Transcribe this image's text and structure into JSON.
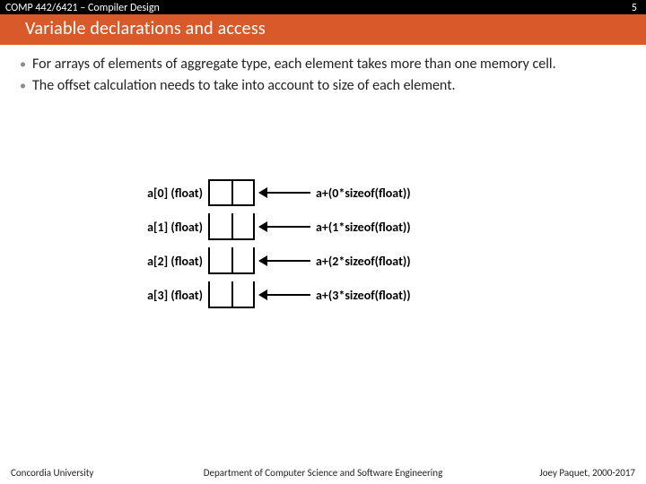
{
  "header": {
    "course": "COMP 442/6421 – Compiler Design",
    "page_num": "5",
    "title": "Variable declarations and access"
  },
  "bullets": [
    "For arrays of elements of aggregate type, each element takes more than one memory cell.",
    "The offset calculation needs to take into account to size of each element."
  ],
  "diagram": {
    "rows": [
      {
        "left": "a[0] (float)",
        "right": "a+(0*sizeof(float))"
      },
      {
        "left": "a[1] (float)",
        "right": "a+(1*sizeof(float))"
      },
      {
        "left": "a[2] (float)",
        "right": "a+(2*sizeof(float))"
      },
      {
        "left": "a[3] (float)",
        "right": "a+(3*sizeof(float))"
      }
    ]
  },
  "footer": {
    "left": "Concordia University",
    "mid": "Department of Computer Science and Software Engineering",
    "right": "Joey Paquet, 2000-2017"
  }
}
